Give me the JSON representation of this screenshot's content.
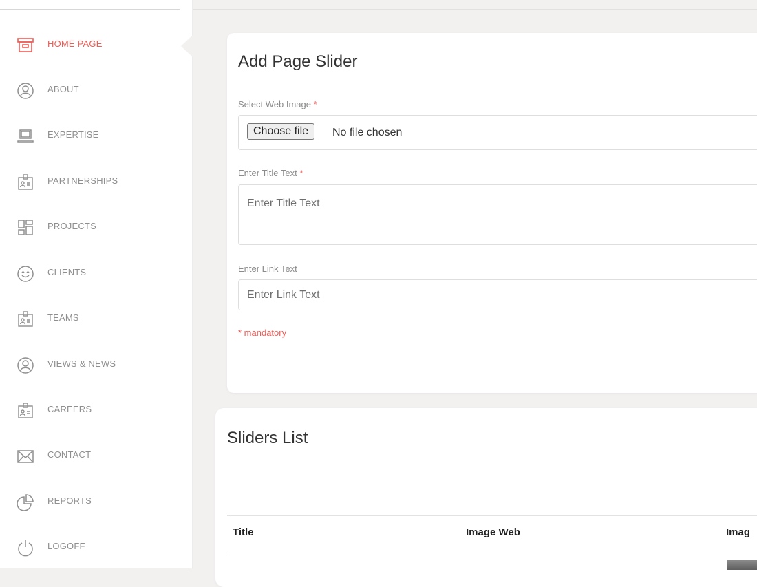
{
  "sidebar": {
    "accent_color": "#ef5b55",
    "items": [
      {
        "label": "HOME PAGE",
        "icon": "home-box-icon",
        "active": true
      },
      {
        "label": "ABOUT",
        "icon": "user-circle-icon",
        "active": false
      },
      {
        "label": "EXPERTISE",
        "icon": "laptop-icon",
        "active": false
      },
      {
        "label": "PARTNERSHIPS",
        "icon": "id-badge-icon",
        "active": false
      },
      {
        "label": "PROJECTS",
        "icon": "dashboard-grid-icon",
        "active": false
      },
      {
        "label": "CLIENTS",
        "icon": "smiley-icon",
        "active": false
      },
      {
        "label": "TEAMS",
        "icon": "id-badge-icon",
        "active": false
      },
      {
        "label": "VIEWS & NEWS",
        "icon": "user-circle-icon",
        "active": false
      },
      {
        "label": "CAREERS",
        "icon": "id-badge-icon",
        "active": false
      },
      {
        "label": "CONTACT",
        "icon": "envelope-icon",
        "active": false
      },
      {
        "label": "REPORTS",
        "icon": "pie-chart-icon",
        "active": false
      },
      {
        "label": "LOGOFF",
        "icon": "power-icon",
        "active": false
      }
    ]
  },
  "add_form": {
    "title": "Add Page Slider",
    "web_image": {
      "label": "Select Web Image",
      "required_mark": "*",
      "button_label": "Choose file",
      "status": "No file chosen"
    },
    "title_text": {
      "label": "Enter Title Text",
      "required_mark": "*",
      "placeholder": "Enter Title Text",
      "value": ""
    },
    "link_text": {
      "label": "Enter Link Text",
      "placeholder": "Enter Link Text",
      "value": ""
    },
    "mandatory_note": {
      "mark": "*",
      "text": " mandatory"
    }
  },
  "sliders_list": {
    "title": "Sliders List",
    "columns": [
      "Title",
      "Image Web",
      "Imag"
    ]
  }
}
